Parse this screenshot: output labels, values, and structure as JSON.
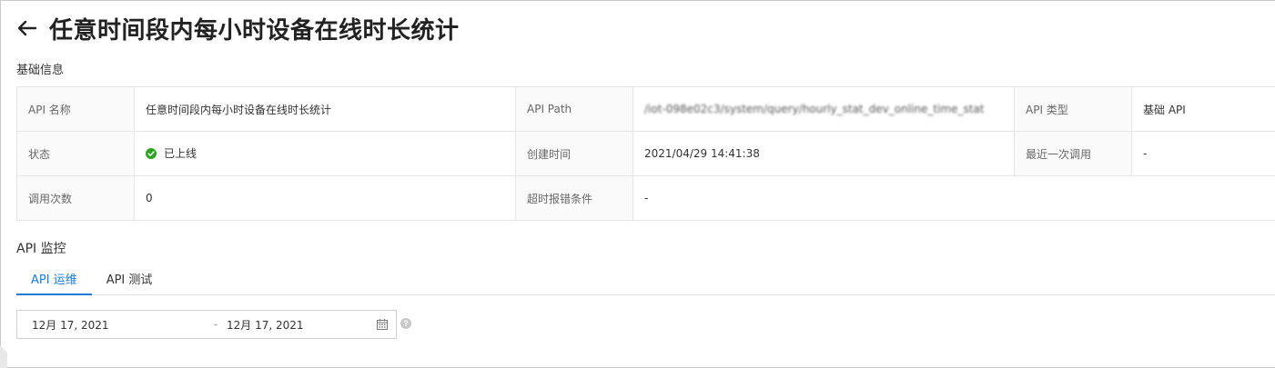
{
  "header": {
    "back_icon": "arrow-left-icon",
    "title": "任意时间段内每小时设备在线时长统计"
  },
  "basic_info": {
    "section_title": "基础信息",
    "rows": [
      [
        {
          "label": "API 名称",
          "value": "任意时间段内每小时设备在线时长统计"
        },
        {
          "label": "API Path",
          "value": "/iot-098e02c3/system/query/hourly_stat_dev_online_time_stat"
        },
        {
          "label": "API 类型",
          "value": "基础 API"
        }
      ],
      [
        {
          "label": "状态",
          "value": "已上线",
          "icon": "check-circle-icon",
          "color": "#2ea121"
        },
        {
          "label": "创建时间",
          "value": "2021/04/29 14:41:38"
        },
        {
          "label": "最近一次调用",
          "value": "-"
        }
      ],
      [
        {
          "label": "调用次数",
          "value": "0"
        },
        {
          "label": "超时报错条件",
          "value": "-"
        }
      ]
    ]
  },
  "monitor": {
    "title": "API 监控",
    "tabs": [
      {
        "label": "API 运维",
        "active": true
      },
      {
        "label": "API 测试",
        "active": false
      }
    ],
    "date_range": {
      "start": "12月 17, 2021",
      "separator": "-",
      "end": "12月 17, 2021",
      "calendar_icon": "calendar-icon"
    },
    "help_icon": "question-circle-icon",
    "accent_color": "#1e7bd6"
  }
}
